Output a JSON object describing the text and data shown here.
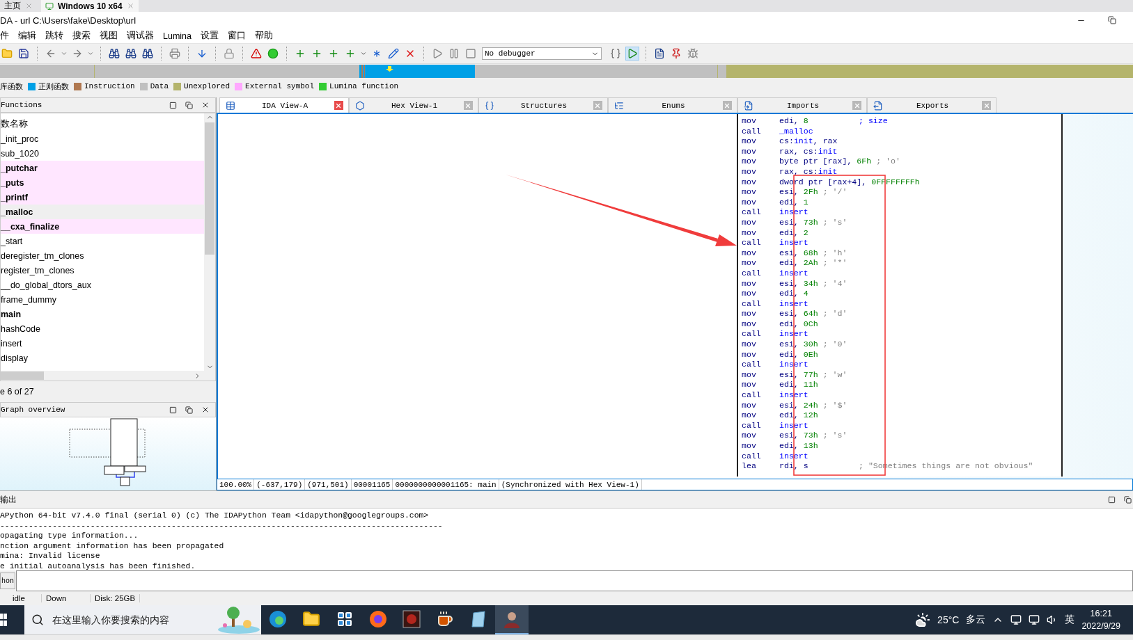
{
  "host_tabs": [
    {
      "label": "主页",
      "selected": false
    },
    {
      "label": "Windows 10 x64",
      "selected": true
    }
  ],
  "window": {
    "title": "DA - url C:\\Users\\fake\\Desktop\\url"
  },
  "menu": [
    "件",
    "编辑",
    "跳转",
    "搜索",
    "视图",
    "调试器",
    "Lumina",
    "设置",
    "窗口",
    "帮助"
  ],
  "toolbar": {
    "debugger": "No debugger"
  },
  "legend": [
    {
      "label": "库函数"
    },
    {
      "label": "正则函数",
      "color": "#00a0e6"
    },
    {
      "label": "Instruction",
      "color": "#b07850"
    },
    {
      "label": "Data",
      "color": "#c0c0c0"
    },
    {
      "label": "Unexplored",
      "color": "#b4b46c"
    },
    {
      "label": "External symbol",
      "color": "#ffa8ff"
    },
    {
      "label": "Lumina function",
      "color": "#33cc33"
    }
  ],
  "functions": {
    "title": "Functions",
    "column": "数名称",
    "status": "e 6 of 27",
    "items": [
      {
        "name": "_init_proc",
        "kind": "regular",
        "bold": false,
        "selected": false
      },
      {
        "name": "sub_1020",
        "kind": "regular",
        "bold": false,
        "selected": false
      },
      {
        "name": "_putchar",
        "kind": "external",
        "bold": true,
        "selected": false
      },
      {
        "name": "_puts",
        "kind": "external",
        "bold": true,
        "selected": false
      },
      {
        "name": "_printf",
        "kind": "external",
        "bold": true,
        "selected": false
      },
      {
        "name": "_malloc",
        "kind": "external",
        "bold": true,
        "selected": true
      },
      {
        "name": "__cxa_finalize",
        "kind": "external",
        "bold": true,
        "selected": false
      },
      {
        "name": "_start",
        "kind": "regular",
        "bold": false,
        "selected": false
      },
      {
        "name": "deregister_tm_clones",
        "kind": "regular",
        "bold": false,
        "selected": false
      },
      {
        "name": "register_tm_clones",
        "kind": "regular",
        "bold": false,
        "selected": false
      },
      {
        "name": "__do_global_dtors_aux",
        "kind": "regular",
        "bold": false,
        "selected": false
      },
      {
        "name": "frame_dummy",
        "kind": "regular",
        "bold": false,
        "selected": false
      },
      {
        "name": "main",
        "kind": "regular",
        "bold": true,
        "selected": false
      },
      {
        "name": "hashCode",
        "kind": "regular",
        "bold": false,
        "selected": false
      },
      {
        "name": "insert",
        "kind": "regular",
        "bold": false,
        "selected": false
      },
      {
        "name": "display",
        "kind": "regular",
        "bold": false,
        "selected": false
      }
    ]
  },
  "graph_overview": {
    "title": "Graph overview"
  },
  "tabs": [
    {
      "label": "IDA View-A",
      "selected": true
    },
    {
      "label": "Hex View-1",
      "selected": false
    },
    {
      "label": "Structures",
      "selected": false
    },
    {
      "label": "Enums",
      "selected": false
    },
    {
      "label": "Imports",
      "selected": false
    },
    {
      "label": "Exports",
      "selected": false
    }
  ],
  "disassembly": [
    {
      "op": "mov",
      "args": [
        {
          "text": "edi, ",
          "kind": "reg"
        },
        {
          "text": "8",
          "kind": "num"
        }
      ],
      "comment": {
        "text": "; size",
        "kind": "note"
      }
    },
    {
      "op": "call",
      "args": [
        {
          "text": "_malloc",
          "kind": "name"
        }
      ]
    },
    {
      "op": "mov",
      "args": [
        {
          "text": "cs:",
          "kind": "reg"
        },
        {
          "text": "init",
          "kind": "name"
        },
        {
          "text": ", rax",
          "kind": "reg"
        }
      ]
    },
    {
      "op": "mov",
      "args": [
        {
          "text": "rax, cs:",
          "kind": "reg"
        },
        {
          "text": "init",
          "kind": "name"
        }
      ]
    },
    {
      "op": "mov",
      "args": [
        {
          "text": "byte ptr [rax], ",
          "kind": "reg"
        },
        {
          "text": "6Fh",
          "kind": "num"
        }
      ],
      "comment": {
        "text": "; 'o'",
        "kind": "char"
      }
    },
    {
      "op": "mov",
      "args": [
        {
          "text": "rax, cs:",
          "kind": "reg"
        },
        {
          "text": "init",
          "kind": "name"
        }
      ]
    },
    {
      "op": "mov",
      "args": [
        {
          "text": "dword ptr [rax+4], ",
          "kind": "reg"
        },
        {
          "text": "0FFFFFFFFh",
          "kind": "num"
        }
      ]
    },
    {
      "op": "mov",
      "args": [
        {
          "text": "esi, ",
          "kind": "reg"
        },
        {
          "text": "2Fh",
          "kind": "num"
        }
      ],
      "comment": {
        "text": "; '/'",
        "kind": "char"
      }
    },
    {
      "op": "mov",
      "args": [
        {
          "text": "edi, ",
          "kind": "reg"
        },
        {
          "text": "1",
          "kind": "num"
        }
      ]
    },
    {
      "op": "call",
      "args": [
        {
          "text": "insert",
          "kind": "name"
        }
      ]
    },
    {
      "op": "mov",
      "args": [
        {
          "text": "esi, ",
          "kind": "reg"
        },
        {
          "text": "73h",
          "kind": "num"
        }
      ],
      "comment": {
        "text": "; 's'",
        "kind": "char"
      }
    },
    {
      "op": "mov",
      "args": [
        {
          "text": "edi, ",
          "kind": "reg"
        },
        {
          "text": "2",
          "kind": "num"
        }
      ]
    },
    {
      "op": "call",
      "args": [
        {
          "text": "insert",
          "kind": "name"
        }
      ]
    },
    {
      "op": "mov",
      "args": [
        {
          "text": "esi, ",
          "kind": "reg"
        },
        {
          "text": "68h",
          "kind": "num"
        }
      ],
      "comment": {
        "text": "; 'h'",
        "kind": "char"
      }
    },
    {
      "op": "mov",
      "args": [
        {
          "text": "edi, ",
          "kind": "reg"
        },
        {
          "text": "2Ah",
          "kind": "num"
        }
      ],
      "comment": {
        "text": "; '*'",
        "kind": "char"
      }
    },
    {
      "op": "call",
      "args": [
        {
          "text": "insert",
          "kind": "name"
        }
      ]
    },
    {
      "op": "mov",
      "args": [
        {
          "text": "esi, ",
          "kind": "reg"
        },
        {
          "text": "34h",
          "kind": "num"
        }
      ],
      "comment": {
        "text": "; '4'",
        "kind": "char"
      }
    },
    {
      "op": "mov",
      "args": [
        {
          "text": "edi, ",
          "kind": "reg"
        },
        {
          "text": "4",
          "kind": "num"
        }
      ]
    },
    {
      "op": "call",
      "args": [
        {
          "text": "insert",
          "kind": "name"
        }
      ]
    },
    {
      "op": "mov",
      "args": [
        {
          "text": "esi, ",
          "kind": "reg"
        },
        {
          "text": "64h",
          "kind": "num"
        }
      ],
      "comment": {
        "text": "; 'd'",
        "kind": "char"
      }
    },
    {
      "op": "mov",
      "args": [
        {
          "text": "edi, ",
          "kind": "reg"
        },
        {
          "text": "0Ch",
          "kind": "num"
        }
      ]
    },
    {
      "op": "call",
      "args": [
        {
          "text": "insert",
          "kind": "name"
        }
      ]
    },
    {
      "op": "mov",
      "args": [
        {
          "text": "esi, ",
          "kind": "reg"
        },
        {
          "text": "30h",
          "kind": "num"
        }
      ],
      "comment": {
        "text": "; '0'",
        "kind": "char"
      }
    },
    {
      "op": "mov",
      "args": [
        {
          "text": "edi, ",
          "kind": "reg"
        },
        {
          "text": "0Eh",
          "kind": "num"
        }
      ]
    },
    {
      "op": "call",
      "args": [
        {
          "text": "insert",
          "kind": "name"
        }
      ]
    },
    {
      "op": "mov",
      "args": [
        {
          "text": "esi, ",
          "kind": "reg"
        },
        {
          "text": "77h",
          "kind": "num"
        }
      ],
      "comment": {
        "text": "; 'w'",
        "kind": "char"
      }
    },
    {
      "op": "mov",
      "args": [
        {
          "text": "edi, ",
          "kind": "reg"
        },
        {
          "text": "11h",
          "kind": "num"
        }
      ]
    },
    {
      "op": "call",
      "args": [
        {
          "text": "insert",
          "kind": "name"
        }
      ]
    },
    {
      "op": "mov",
      "args": [
        {
          "text": "esi, ",
          "kind": "reg"
        },
        {
          "text": "24h",
          "kind": "num"
        }
      ],
      "comment": {
        "text": "; '$'",
        "kind": "char"
      }
    },
    {
      "op": "mov",
      "args": [
        {
          "text": "edi, ",
          "kind": "reg"
        },
        {
          "text": "12h",
          "kind": "num"
        }
      ]
    },
    {
      "op": "call",
      "args": [
        {
          "text": "insert",
          "kind": "name"
        }
      ]
    },
    {
      "op": "mov",
      "args": [
        {
          "text": "esi, ",
          "kind": "reg"
        },
        {
          "text": "73h",
          "kind": "num"
        }
      ],
      "comment": {
        "text": "; 's'",
        "kind": "char"
      }
    },
    {
      "op": "mov",
      "args": [
        {
          "text": "edi, ",
          "kind": "reg"
        },
        {
          "text": "13h",
          "kind": "num"
        }
      ]
    },
    {
      "op": "call",
      "args": [
        {
          "text": "insert",
          "kind": "name"
        }
      ]
    },
    {
      "op": "lea",
      "args": [
        {
          "text": "rdi, s",
          "kind": "reg"
        }
      ],
      "comment": {
        "text": "; \"Sometimes things are not obvious\"",
        "kind": "string"
      }
    }
  ],
  "view_status": [
    "100.00%",
    "(-637,179)",
    "(971,501)",
    "00001165",
    "0000000000001165: main",
    "(Synchronized with Hex View-1)"
  ],
  "output": {
    "title": "输出",
    "lines": [
      "APython 64-bit v7.4.0 final (serial 0) (c) The IDAPython Team <idapython@googlegroups.com>",
      "---------------------------------------------------------------------------------------------",
      "opagating type information...",
      "nction argument information has been propagated",
      "mina: Invalid license",
      "e initial autoanalysis has been finished."
    ],
    "input_label": "hon"
  },
  "status_bar": [
    "idle",
    "Down",
    "Disk: 25GB"
  ],
  "taskbar": {
    "search_placeholder": "在这里输入你要搜索的内容",
    "temperature": "25°C",
    "weather": "多云",
    "ime": "英",
    "time": "16:21",
    "date": "2022/9/29"
  }
}
